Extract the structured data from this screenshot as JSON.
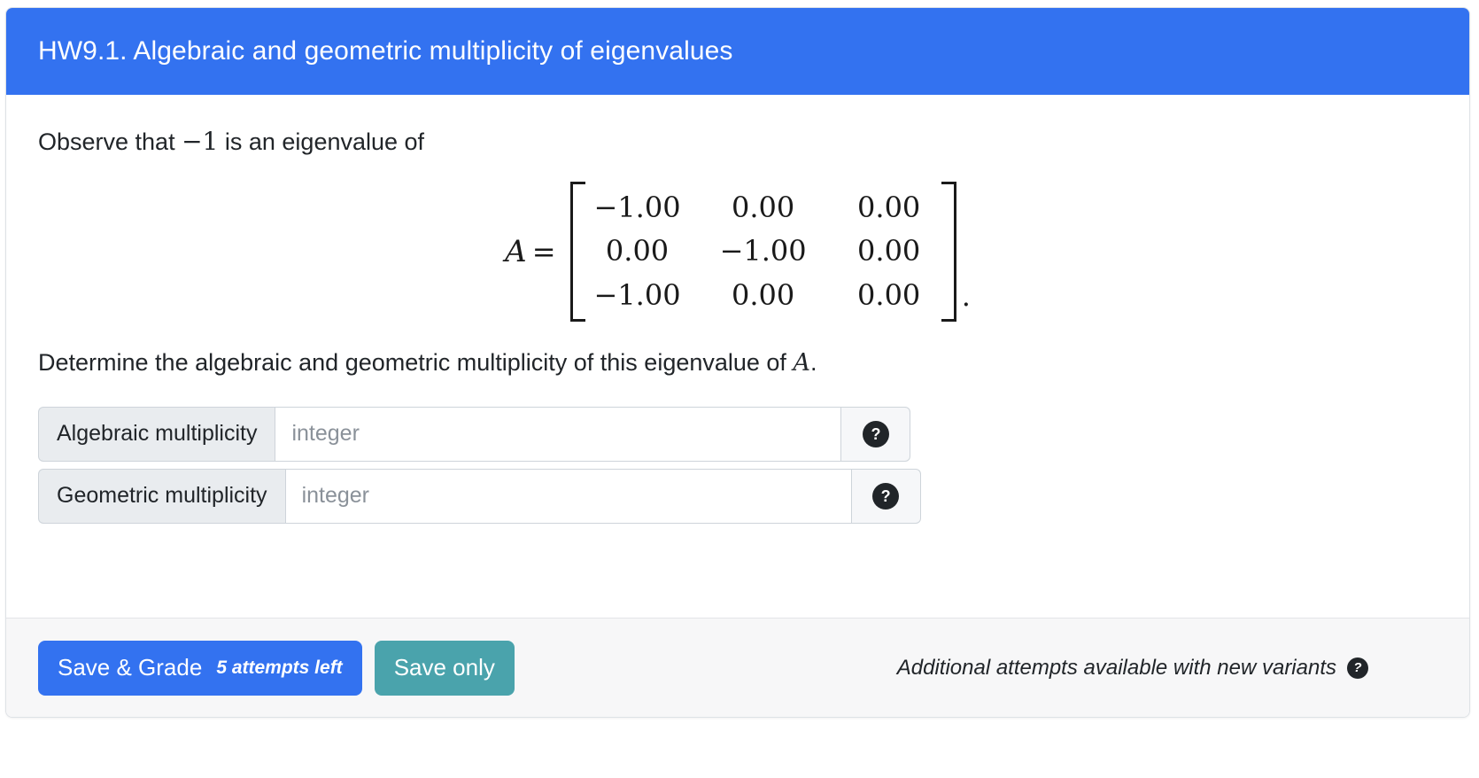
{
  "header": {
    "title": "HW9.1. Algebraic and geometric multiplicity of eigenvalues",
    "accent_color": "#3372f0"
  },
  "body": {
    "intro_prefix": "Observe that ",
    "intro_value": "−1",
    "intro_suffix": " is an eigenvalue of",
    "matrix": {
      "lhs_symbol": "A",
      "equals": "=",
      "rows": [
        [
          "−1.00",
          "0.00",
          "0.00"
        ],
        [
          "0.00",
          "−1.00",
          "0.00"
        ],
        [
          "−1.00",
          "0.00",
          "0.00"
        ]
      ],
      "trailing_punctuation": "."
    },
    "question_prefix": "Determine the algebraic and geometric multiplicity of this eigenvalue of ",
    "question_symbol": "A",
    "question_suffix": "."
  },
  "answers": [
    {
      "label": "Algebraic multiplicity",
      "value": "",
      "placeholder": "integer",
      "help_glyph": "?"
    },
    {
      "label": "Geometric multiplicity",
      "value": "",
      "placeholder": "integer",
      "help_glyph": "?"
    }
  ],
  "footer": {
    "save_grade_label": "Save & Grade",
    "attempts_left_label": "5 attempts left",
    "save_only_label": "Save only",
    "variants_note": "Additional attempts available with new variants",
    "variants_help_glyph": "?",
    "primary_color": "#3372f0",
    "secondary_color": "#4aa3ac"
  }
}
